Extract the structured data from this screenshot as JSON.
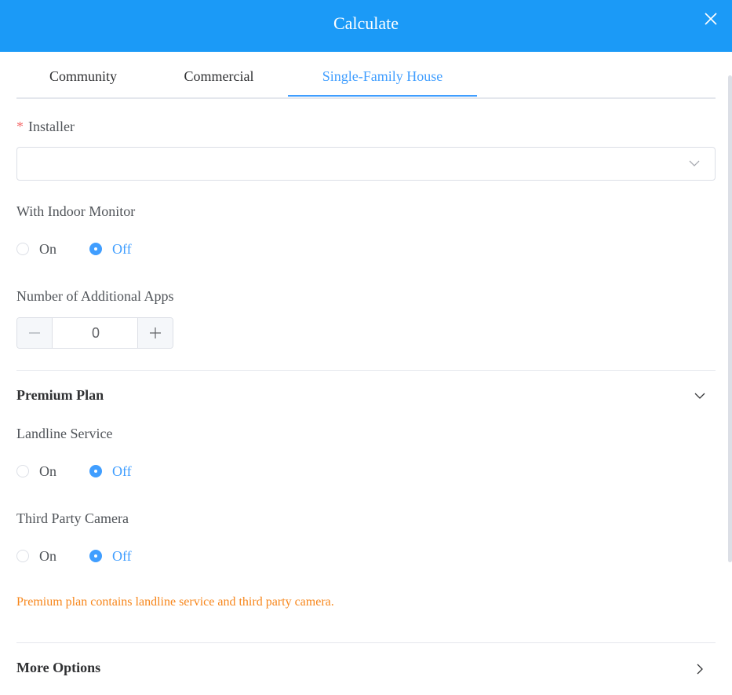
{
  "dialog": {
    "title": "Calculate",
    "close_icon": "close-icon"
  },
  "tabs": [
    {
      "label": "Community",
      "active": false
    },
    {
      "label": "Commercial",
      "active": false
    },
    {
      "label": "Single-Family House",
      "active": true
    }
  ],
  "form": {
    "installer": {
      "required_mark": "*",
      "label": "Installer",
      "value": "",
      "placeholder": ""
    },
    "indoor_monitor": {
      "label": "With Indoor Monitor",
      "options": [
        "On",
        "Off"
      ],
      "selected": "Off"
    },
    "additional_apps": {
      "label": "Number of Additional Apps",
      "value": "0",
      "minus": "−",
      "plus": "+"
    }
  },
  "premium_plan": {
    "title": "Premium Plan",
    "expanded": true,
    "landline": {
      "label": "Landline Service",
      "options": [
        "On",
        "Off"
      ],
      "selected": "Off"
    },
    "camera": {
      "label": "Third Party Camera",
      "options": [
        "On",
        "Off"
      ],
      "selected": "Off"
    },
    "note": "Premium plan contains landline service and third party camera."
  },
  "more_options": {
    "title": "More Options",
    "expanded": false
  },
  "colors": {
    "header": "#1b9af7",
    "accent": "#409eff",
    "note": "#f7861b",
    "required": "#f56c6c"
  }
}
